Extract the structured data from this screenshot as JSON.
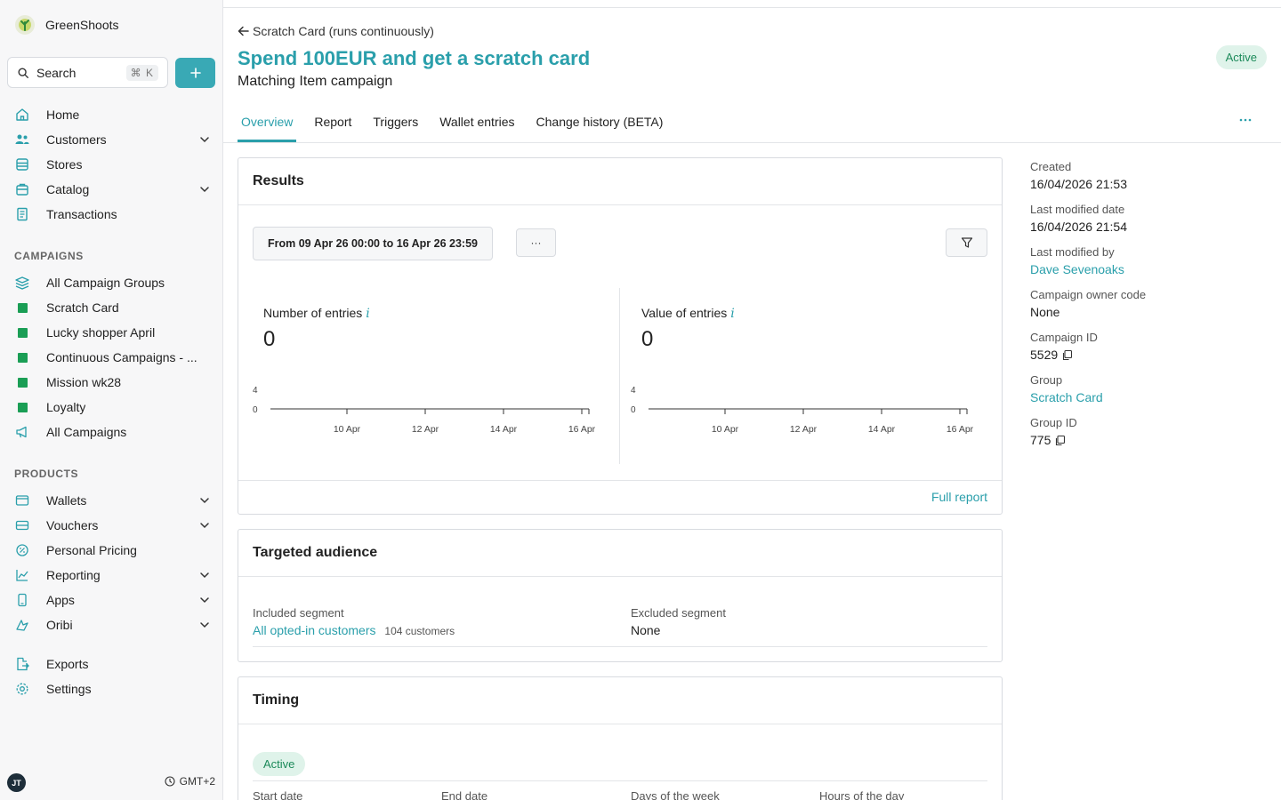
{
  "app": {
    "name": "GreenShoots"
  },
  "search": {
    "label": "Search",
    "shortcut": "⌘ K"
  },
  "nav": [
    {
      "label": "Home",
      "icon": "home-icon",
      "chevron": false
    },
    {
      "label": "Customers",
      "icon": "users-icon",
      "chevron": true
    },
    {
      "label": "Stores",
      "icon": "store-icon",
      "chevron": false
    },
    {
      "label": "Catalog",
      "icon": "catalog-icon",
      "chevron": true
    },
    {
      "label": "Transactions",
      "icon": "receipt-icon",
      "chevron": false
    }
  ],
  "campaigns_section": "CAMPAIGNS",
  "campaigns": [
    {
      "label": "All Campaign Groups",
      "icon": "layers-icon"
    },
    {
      "label": "Scratch Card",
      "icon": "green-square-icon"
    },
    {
      "label": "Lucky shopper April",
      "icon": "green-square-icon"
    },
    {
      "label": "Continuous Campaigns - ...",
      "icon": "green-square-icon"
    },
    {
      "label": "Mission wk28",
      "icon": "green-square-icon"
    },
    {
      "label": "Loyalty",
      "icon": "green-square-icon"
    },
    {
      "label": "All Campaigns",
      "icon": "megaphone-icon"
    }
  ],
  "products_section": "PRODUCTS",
  "products": [
    {
      "label": "Wallets",
      "icon": "wallet-icon",
      "chevron": true
    },
    {
      "label": "Vouchers",
      "icon": "voucher-icon",
      "chevron": true
    },
    {
      "label": "Personal Pricing",
      "icon": "percent-icon",
      "chevron": false
    },
    {
      "label": "Reporting",
      "icon": "chart-icon",
      "chevron": true
    },
    {
      "label": "Apps",
      "icon": "phone-icon",
      "chevron": true
    },
    {
      "label": "Oribi",
      "icon": "oribi-icon",
      "chevron": true
    }
  ],
  "bottom_nav": [
    {
      "label": "Exports",
      "icon": "export-icon"
    },
    {
      "label": "Settings",
      "icon": "gear-icon"
    }
  ],
  "footer": {
    "avatar": "JT",
    "timezone": "GMT+2"
  },
  "header": {
    "back": "Scratch Card (runs continuously)",
    "title": "Spend 100EUR and get a scratch card",
    "subtitle": "Matching Item campaign",
    "status": "Active"
  },
  "tabs": [
    "Overview",
    "Report",
    "Triggers",
    "Wallet entries",
    "Change history (BETA)"
  ],
  "results": {
    "title": "Results",
    "date_range": "From 09 Apr 26 00:00 to 16 Apr 26 23:59",
    "dots": "···",
    "metrics": [
      {
        "title": "Number of entries",
        "info": "i",
        "value": "0"
      },
      {
        "title": "Value of entries",
        "info": "i",
        "value": "0"
      }
    ],
    "full_report": "Full report"
  },
  "chart_data": [
    {
      "type": "line",
      "title": "Number of entries",
      "x": [
        "10 Apr",
        "12 Apr",
        "14 Apr",
        "16 Apr"
      ],
      "y_ticks": [
        "4",
        "0"
      ],
      "ylim": [
        0,
        4
      ],
      "series": []
    },
    {
      "type": "line",
      "title": "Value of entries",
      "x": [
        "10 Apr",
        "12 Apr",
        "14 Apr",
        "16 Apr"
      ],
      "y_ticks": [
        "4",
        "0"
      ],
      "ylim": [
        0,
        4
      ],
      "series": []
    }
  ],
  "audience": {
    "title": "Targeted audience",
    "included_label": "Included segment",
    "included_value": "All opted-in customers",
    "included_count": "104 customers",
    "excluded_label": "Excluded segment",
    "excluded_value": "None"
  },
  "timing": {
    "title": "Timing",
    "status": "Active",
    "columns": [
      "Start date",
      "End date",
      "Days of the week",
      "Hours of the day"
    ]
  },
  "meta": [
    {
      "label": "Created",
      "value": "16/04/2026 21:53",
      "link": false,
      "copy": false
    },
    {
      "label": "Last modified date",
      "value": "16/04/2026 21:54",
      "link": false,
      "copy": false
    },
    {
      "label": "Last modified by",
      "value": "Dave Sevenoaks",
      "link": true,
      "copy": false
    },
    {
      "label": "Campaign owner code",
      "value": "None",
      "link": false,
      "copy": false
    },
    {
      "label": "Campaign ID",
      "value": "5529",
      "link": false,
      "copy": true
    },
    {
      "label": "Group",
      "value": "Scratch Card",
      "link": true,
      "copy": false
    },
    {
      "label": "Group ID",
      "value": "775",
      "link": false,
      "copy": true
    }
  ],
  "colors": {
    "accent": "#2a9fab",
    "button": "#39a9b5",
    "active_bg": "#dff3ea",
    "active_text": "#1c8a5a",
    "campaign_square": "#1a9e55"
  }
}
